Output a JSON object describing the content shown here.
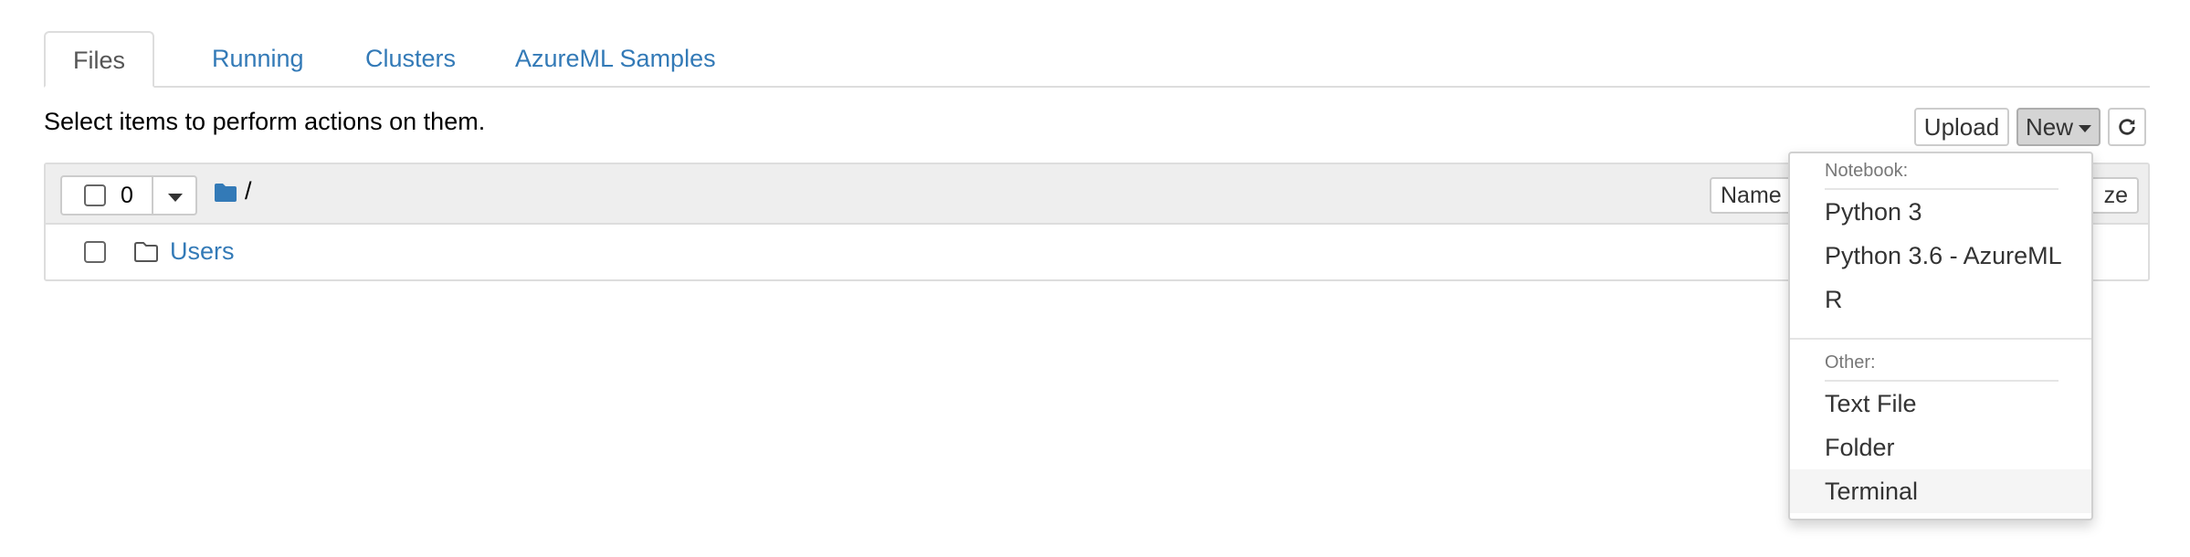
{
  "tabs": {
    "files": "Files",
    "running": "Running",
    "clusters": "Clusters",
    "samples": "AzureML Samples"
  },
  "hint": "Select items to perform actions on them.",
  "toolbar": {
    "upload": "Upload",
    "new": "New"
  },
  "list_header": {
    "selected_count": "0",
    "path": "/",
    "sort_name": "Name",
    "sort_size": "ze"
  },
  "rows": [
    {
      "name": "Users"
    }
  ],
  "new_menu": {
    "notebook_header": "Notebook:",
    "notebook_items": [
      "Python 3",
      "Python 3.6 - AzureML",
      "R"
    ],
    "other_header": "Other:",
    "other_items": [
      "Text File",
      "Folder",
      "Terminal"
    ],
    "highlighted": "Terminal"
  },
  "colors": {
    "link": "#337ab7",
    "active_tab_text": "#555555",
    "header_bg": "#eeeeee",
    "menu_highlight": "#f5f5f5"
  },
  "icons": [
    "folder-solid-icon",
    "folder-outline-icon",
    "refresh-icon",
    "caret-down-icon"
  ]
}
